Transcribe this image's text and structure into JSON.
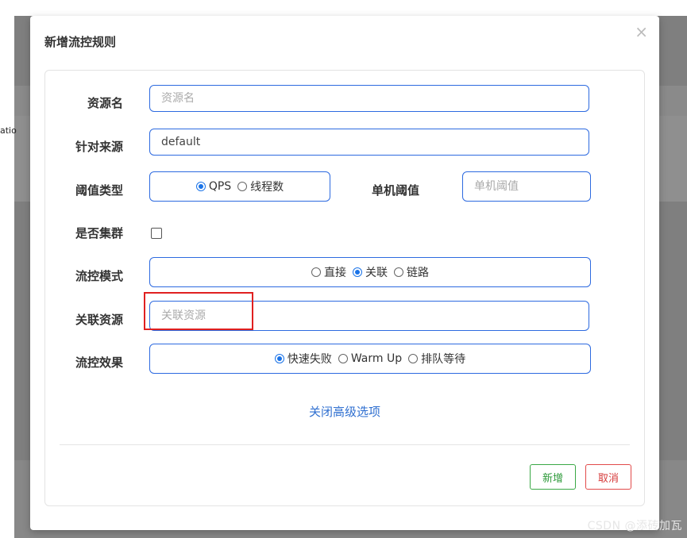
{
  "background": {
    "partial_text": "atio"
  },
  "modal": {
    "title": "新增流控规则",
    "close_glyph": "×",
    "fields": {
      "resource": {
        "label": "资源名",
        "placeholder": "资源名",
        "value": ""
      },
      "source": {
        "label": "针对来源",
        "value": "default"
      },
      "threshold_type": {
        "label": "阈值类型",
        "options": [
          "QPS",
          "线程数"
        ],
        "selected": "QPS"
      },
      "single_threshold": {
        "label": "单机阈值",
        "placeholder": "单机阈值"
      },
      "cluster": {
        "label": "是否集群",
        "checked": false
      },
      "flow_mode": {
        "label": "流控模式",
        "options": [
          "直接",
          "关联",
          "链路"
        ],
        "selected": "关联"
      },
      "related_resource": {
        "label": "关联资源",
        "placeholder": "关联资源"
      },
      "flow_effect": {
        "label": "流控效果",
        "options": [
          "快速失败",
          "Warm Up",
          "排队等待"
        ],
        "selected": "快速失败"
      }
    },
    "advanced_link": "关闭高级选项",
    "buttons": {
      "add": "新增",
      "cancel": "取消"
    }
  },
  "watermark": "CSDN @添砖加瓦",
  "colors": {
    "accent": "#2d6ae0",
    "highlight": "#e02020",
    "add": "#3aa845",
    "cancel": "#e24a4a"
  }
}
